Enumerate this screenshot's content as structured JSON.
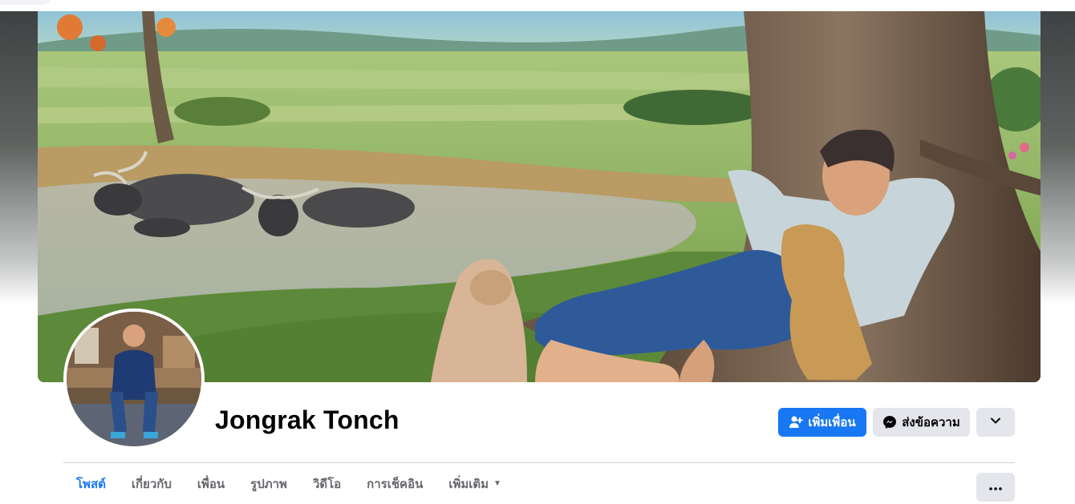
{
  "profile": {
    "name": "Jongrak Tonch"
  },
  "actions": {
    "add_friend_label": "เพิ่มเพื่อน",
    "message_label": "ส่งข้อความ",
    "add_friend_icon": "person-plus-icon",
    "message_icon": "messenger-icon",
    "dropdown_icon": "chevron-down-icon"
  },
  "tabs": [
    {
      "label": "โพสต์",
      "active": true
    },
    {
      "label": "เกี่ยวกับ",
      "active": false
    },
    {
      "label": "เพื่อน",
      "active": false
    },
    {
      "label": "รูปภาพ",
      "active": false
    },
    {
      "label": "วิดีโอ",
      "active": false
    },
    {
      "label": "การเช็คอิน",
      "active": false
    },
    {
      "label": "เพิ่มเติม",
      "active": false
    }
  ],
  "colors": {
    "primary": "#1877f2",
    "secondary_bg": "#e4e6eb",
    "text": "#050505",
    "muted": "#65676b"
  }
}
